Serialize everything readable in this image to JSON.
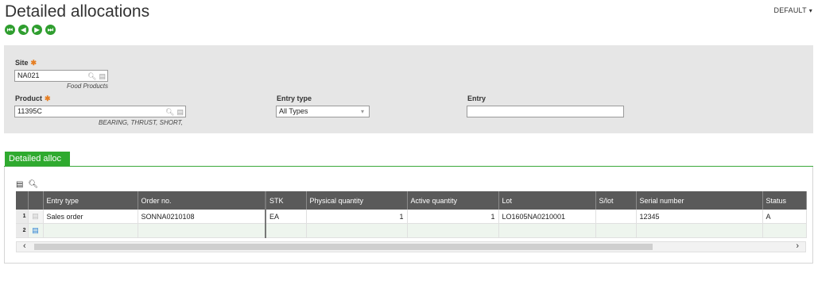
{
  "page": {
    "title": "Detailed allocations",
    "view": "DEFAULT"
  },
  "nav": [
    "first",
    "previous",
    "next",
    "last"
  ],
  "form": {
    "site": {
      "label": "Site",
      "value": "NA021",
      "description": "Food Products"
    },
    "product": {
      "label": "Product",
      "value": "11395C",
      "description": "BEARING, THRUST, SHORT,"
    },
    "entry_type": {
      "label": "Entry type",
      "value": "All Types"
    },
    "entry": {
      "label": "Entry",
      "value": ""
    }
  },
  "tab": {
    "label": "Detailed alloc"
  },
  "grid": {
    "columns": [
      "Entry type",
      "Order no.",
      "STK",
      "Physical quantity",
      "Active quantity",
      "Lot",
      "S/lot",
      "Serial number",
      "Status"
    ],
    "rows": [
      {
        "num": "1",
        "entry_type": "Sales order",
        "order_no": "SONNA0210108",
        "stk": "EA",
        "physical_qty": "1",
        "active_qty": "1",
        "lot": "LO1605NA0210001",
        "slot": "",
        "serial": "12345",
        "status": "A"
      },
      {
        "num": "2",
        "entry_type": "",
        "order_no": "",
        "stk": "",
        "physical_qty": "",
        "active_qty": "",
        "lot": "",
        "slot": "",
        "serial": "",
        "status": ""
      }
    ]
  },
  "icons": {
    "accent": "#2faa2f",
    "required": "#e67e22"
  }
}
